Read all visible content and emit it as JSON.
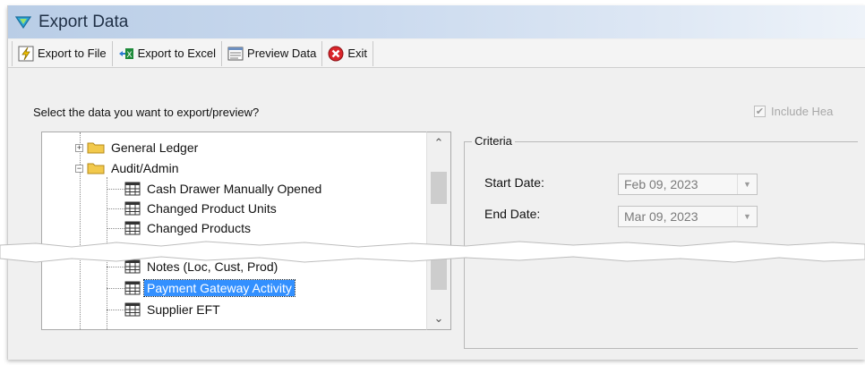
{
  "window": {
    "title": "Export Data"
  },
  "toolbar": {
    "export_file": "Export to File",
    "export_excel": "Export to Excel",
    "preview": "Preview Data",
    "exit": "Exit"
  },
  "prompt": "Select the data you want to export/preview?",
  "include_headers": {
    "label": "Include Hea",
    "checked": true
  },
  "tree": {
    "general_ledger": "General Ledger",
    "audit_admin": "Audit/Admin",
    "items": [
      "Cash Drawer Manually Opened",
      "Changed Product Units",
      "Changed Products",
      "Notes (Loc, Cust, Prod)",
      "Payment Gateway Activity",
      "Supplier EFT"
    ],
    "selected": "Payment Gateway Activity"
  },
  "criteria": {
    "legend": "Criteria",
    "start_label": "Start Date:",
    "start_value": "Feb 09, 2023",
    "end_label": "End Date:",
    "end_value": "Mar 09, 2023"
  },
  "colors": {
    "accent": "#3390ff",
    "title_bar": "#c9d9ee",
    "folder": "#f2c94c",
    "exit_red": "#d9252a"
  }
}
